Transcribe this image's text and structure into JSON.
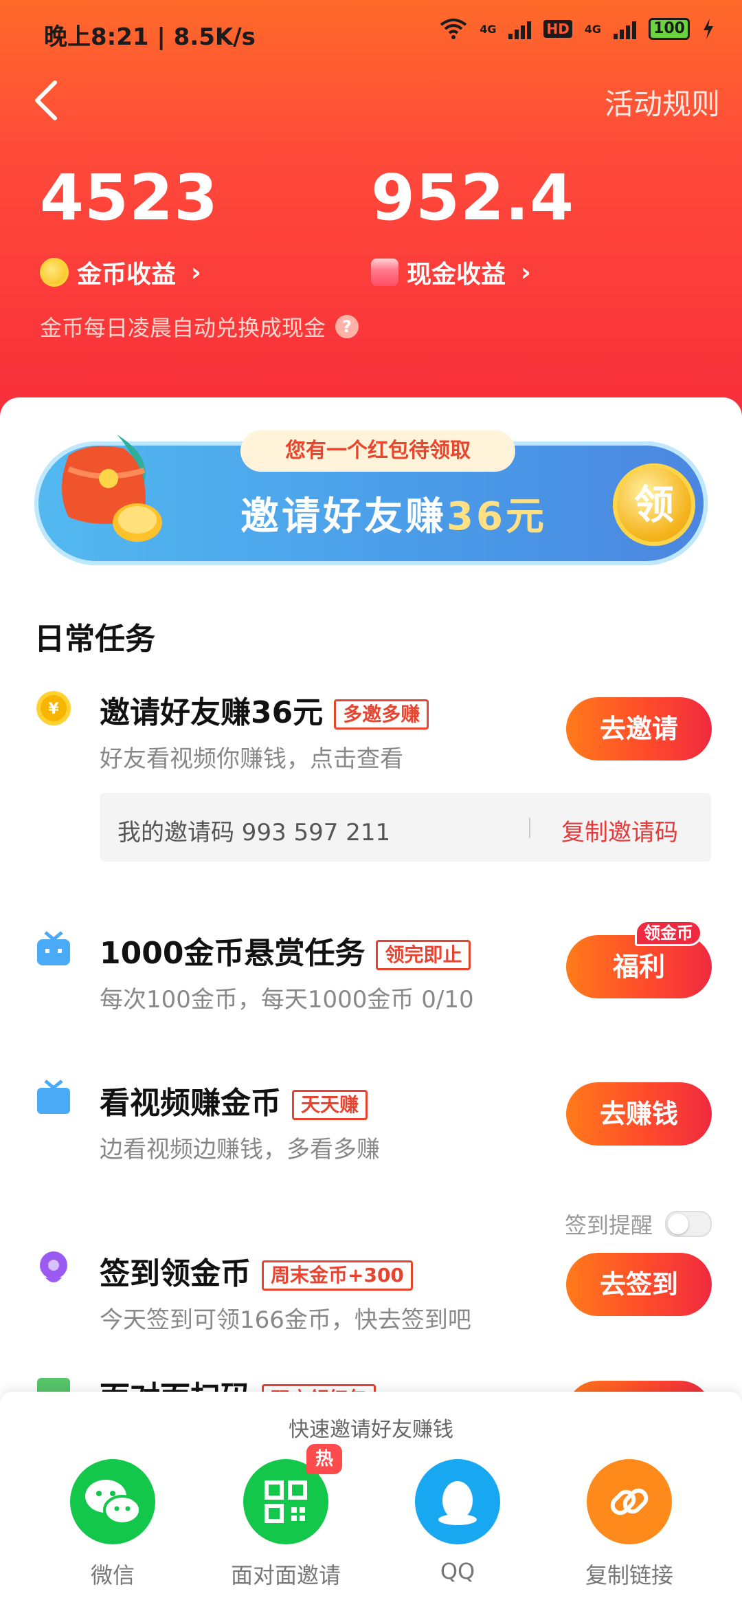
{
  "status_bar": {
    "time": "晚上8:21 | 8.5K/s",
    "network_1": "4G",
    "hd": "HD",
    "network_2": "4G",
    "battery": "100"
  },
  "header": {
    "back_label": "‹",
    "rules": "活动规则",
    "coins_value": "4523",
    "coins_label": "金币收益",
    "cash_value": "952.4",
    "cash_label": "现金收益",
    "tip": "金币每日凌晨自动兑换成现金",
    "tip_icon": "?"
  },
  "banner": {
    "pill": "您有一个红包待领取",
    "title_prefix": "邀请好友赚",
    "title_amount": "36元",
    "claim": "领"
  },
  "daily": {
    "title": "日常任务",
    "tasks": [
      {
        "name": "邀请好友赚36元",
        "badge": "多邀多赚",
        "desc": "好友看视频你赚钱，点击查看",
        "button": "去邀请"
      },
      {
        "name": "1000金币悬赏任务",
        "badge": "领完即止",
        "desc": "每次100金币，每天1000金币 0/10",
        "button": "福利",
        "corner_tag": "领金币"
      },
      {
        "name": "看视频赚金币",
        "badge": "天天赚",
        "desc": "边看视频边赚钱，多看多赚",
        "button": "去赚钱"
      },
      {
        "name": "签到领金币",
        "badge": "周末金币+300",
        "desc": "今天签到可领166金币，快去签到吧",
        "button": "去签到"
      },
      {
        "name": "面对面扫码",
        "badge": "双方领红包"
      }
    ],
    "invite_code_label": "我的邀请码 993 597 211",
    "copy_code": "复制邀请码",
    "remind_label": "签到提醒"
  },
  "share": {
    "title": "快速邀请好友赚钱",
    "items": [
      {
        "label": "微信",
        "color": "#13c74a",
        "icon": "wechat-icon"
      },
      {
        "label": "面对面邀请",
        "color": "#13c74a",
        "icon": "qr-code-icon",
        "hot": "热"
      },
      {
        "label": "QQ",
        "color": "#18a8f2",
        "icon": "qq-penguin-icon"
      },
      {
        "label": "复制链接",
        "color": "#ff8a1c",
        "icon": "link-icon"
      }
    ]
  }
}
